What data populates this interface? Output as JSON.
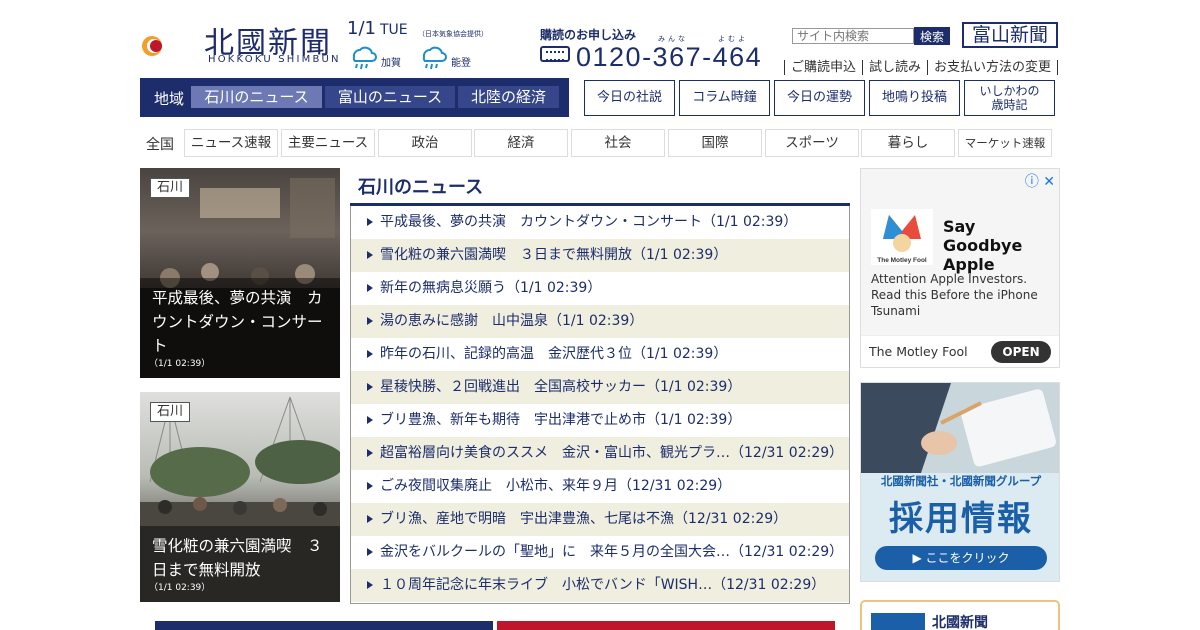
{
  "header": {
    "logo_name": "北國新聞",
    "logo_roman": "HOKKOKU SHIMBUN",
    "date": "1/1",
    "weekday": "TUE",
    "weather_note": "（日本気象協会提供）",
    "weather": [
      {
        "area": "加賀",
        "icon": "rain-icon"
      },
      {
        "area": "能登",
        "icon": "rain-icon"
      }
    ],
    "subscribe_title": "購読のお申し込み",
    "subscribe_ruby": [
      "みんな",
      "よむよ"
    ],
    "phone": "0120-367-464",
    "search_placeholder": "サイト内検索",
    "search_button": "検索",
    "toyama_button": "富山新聞",
    "top_links": [
      "ご購読申込",
      "試し読み",
      "お支払い方法の変更"
    ]
  },
  "region_nav": {
    "label": "地域",
    "tabs": [
      {
        "label": "石川のニュース",
        "active": true
      },
      {
        "label": "富山のニュース",
        "active": false
      },
      {
        "label": "北陸の経済",
        "active": false
      }
    ]
  },
  "feature_buttons": [
    "今日の社説",
    "コラム時鐘",
    "今日の運勢",
    "地鳴り投稿",
    "いしかわの\n歳時記"
  ],
  "categories": {
    "all_label": "全国",
    "items": [
      "ニュース速報",
      "主要ニュース",
      "政治",
      "経済",
      "社会",
      "国際",
      "スポーツ",
      "暮らし",
      "マーケット速報"
    ]
  },
  "photo_stories": [
    {
      "tag": "石川",
      "caption": "平成最後、夢の共演　カウントダウン・コンサート",
      "time": "（1/1 02:39）"
    },
    {
      "tag": "石川",
      "caption": "雪化粧の兼六園満喫　３日まで無料開放",
      "time": "（1/1 02:39）"
    }
  ],
  "news": {
    "title": "石川のニュース",
    "items": [
      "平成最後、夢の共演　カウントダウン・コンサート（1/1 02:39）",
      "雪化粧の兼六園満喫　３日まで無料開放（1/1 02:39）",
      "新年の無病息災願う（1/1 02:39）",
      "湯の恵みに感謝　山中温泉（1/1 02:39）",
      "昨年の石川、記録的高温　金沢歴代３位（1/1 02:39）",
      "星稜快勝、２回戦進出　全国高校サッカー（1/1 02:39）",
      "ブリ豊漁、新年も期待　宇出津港で止め市（1/1 02:39）",
      "超富裕層向け美食のススメ　金沢・富山市、観光プラ…（12/31 02:29）",
      "ごみ夜間収集廃止　小松市、来年９月（12/31 02:29）",
      "ブリ漁、産地で明暗　宇出津豊漁、七尾は不漁（12/31 02:29）",
      "金沢をバルクールの「聖地」に　来年５月の全国大会…（12/31 02:29）",
      "１０周年記念に年末ライブ　小松でバンド「WISH…（12/31 02:29）"
    ]
  },
  "ad": {
    "headline": "Say Goodbye Apple",
    "body": "Attention Apple Investors. Read this Before the iPhone Tsunami",
    "brand": "The Motley Fool",
    "logo_text": "The Motley Fool",
    "cta": "OPEN",
    "close_icon": "ad-info-close-icon"
  },
  "recruit": {
    "group": "北國新聞社・北國新聞グループ",
    "title": "採用情報",
    "button": "▶ ここをクリック"
  },
  "bottom_box": {
    "title": "北國新聞"
  },
  "colors": {
    "brand": "#1d2d6b",
    "active_tab": "#6c79b5",
    "stripe": "#efeedf",
    "recruit_blue": "#1b5fa8"
  }
}
